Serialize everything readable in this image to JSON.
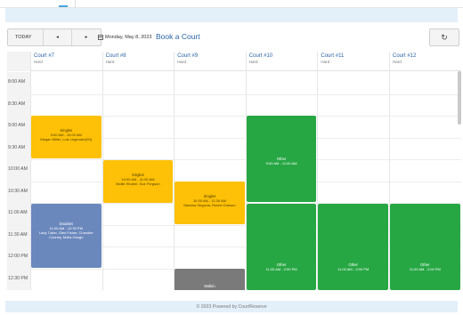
{
  "toolbar": {
    "today_label": "TODAY",
    "prev_label": "◂",
    "next_label": "▸",
    "date_value": "Monday, May 8, 2023",
    "book_label": "Book a Court",
    "refresh_label": "↻"
  },
  "courts": [
    {
      "name": "Court #7",
      "type": "Hard"
    },
    {
      "name": "Court #8",
      "type": "Hard"
    },
    {
      "name": "Court #9",
      "type": "Hard"
    },
    {
      "name": "Court #10",
      "type": "Hard"
    },
    {
      "name": "Court #11",
      "type": "Hard"
    },
    {
      "name": "Court #12",
      "type": "Hard"
    }
  ],
  "times": [
    "8:00 AM",
    "8:30 AM",
    "9:00 AM",
    "9:30 AM",
    "10:00 AM",
    "10:30 AM",
    "11:00 AM",
    "11:30 AM",
    "12:00 PM",
    "12:30 PM"
  ],
  "reservations": [
    {
      "court": 0,
      "title": "Singles",
      "time": "9:00 AM - 10:00 AM",
      "names": "Megan Miller, Luis Legendre(ISI)"
    },
    {
      "court": 1,
      "title": "Singles",
      "time": "10:00 AM - 11:00 AM",
      "names": "Mollie Shober, Sue Fergson"
    },
    {
      "court": 2,
      "title": "Singles",
      "time": "10:30 AM - 11:30 AM",
      "names": "Maxima Segovia, Roche Dobson"
    },
    {
      "court": 0,
      "title": "Doubles",
      "time": "11:00 AM - 12:30 PM",
      "names": "Lady Tuber, Glen Fisher, Chandler Cooney, Molla Gough"
    },
    {
      "court": 3,
      "title": "Other",
      "time": "9:00 AM - 11:00 AM",
      "names": ""
    },
    {
      "court": 3,
      "title": "Other",
      "time": "11:00 AM - 2:00 PM",
      "names": ""
    },
    {
      "court": 4,
      "title": "Other",
      "time": "11:00 AM - 2:00 PM",
      "names": ""
    },
    {
      "court": 5,
      "title": "Other",
      "time": "11:00 AM - 2:00 PM",
      "names": ""
    },
    {
      "court": 2,
      "title": "Walkin",
      "time": "",
      "names": ""
    }
  ],
  "footer": "© 2023 Powered by CourtReserve",
  "colors": {
    "singles": "#fec107",
    "doubles": "#6b88bd",
    "other": "#27a744",
    "walkin": "#7a7a7a",
    "link": "#2a64a5"
  }
}
